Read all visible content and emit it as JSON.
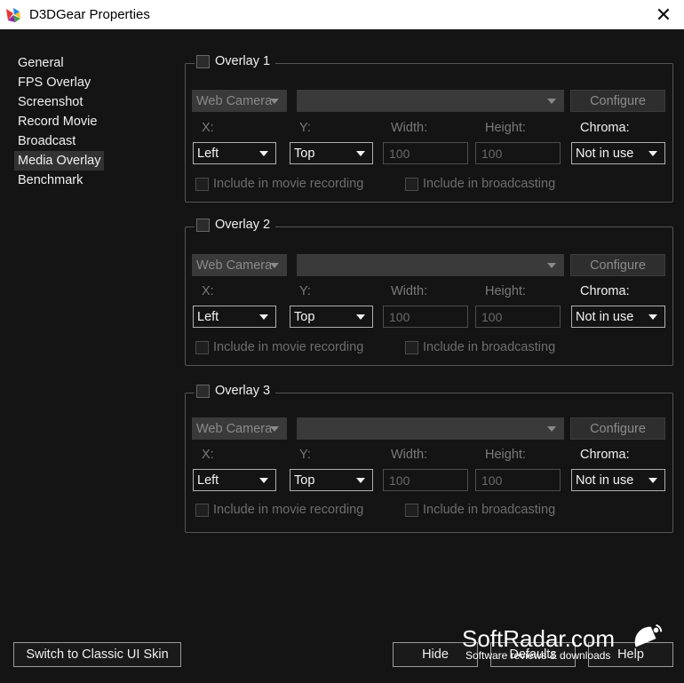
{
  "window": {
    "title": "D3DGear Properties",
    "close_glyph": "✕"
  },
  "nav": {
    "items": [
      "General",
      "FPS Overlay",
      "Screenshot",
      "Record Movie",
      "Broadcast",
      "Media Overlay",
      "Benchmark"
    ],
    "active_index": 5
  },
  "overlays": [
    {
      "title": "Overlay 1",
      "enabled": false,
      "source": "Web Camera",
      "device": "",
      "configure_label": "Configure",
      "x_label": "X:",
      "y_label": "Y:",
      "width_label": "Width:",
      "height_label": "Height:",
      "chroma_label": "Chroma:",
      "x_value": "Left",
      "y_value": "Top",
      "width_value": "100",
      "height_value": "100",
      "chroma_value": "Not in use",
      "movie_label": "Include in movie recording",
      "broadcast_label": "Include in broadcasting"
    },
    {
      "title": "Overlay 2",
      "enabled": false,
      "source": "Web Camera",
      "device": "",
      "configure_label": "Configure",
      "x_label": "X:",
      "y_label": "Y:",
      "width_label": "Width:",
      "height_label": "Height:",
      "chroma_label": "Chroma:",
      "x_value": "Left",
      "y_value": "Top",
      "width_value": "100",
      "height_value": "100",
      "chroma_value": "Not in use",
      "movie_label": "Include in movie recording",
      "broadcast_label": "Include in broadcasting"
    },
    {
      "title": "Overlay 3",
      "enabled": false,
      "source": "Web Camera",
      "device": "",
      "configure_label": "Configure",
      "x_label": "X:",
      "y_label": "Y:",
      "width_label": "Width:",
      "height_label": "Height:",
      "chroma_label": "Chroma:",
      "x_value": "Left",
      "y_value": "Top",
      "width_value": "100",
      "height_value": "100",
      "chroma_value": "Not in use",
      "movie_label": "Include in movie recording",
      "broadcast_label": "Include in broadcasting"
    }
  ],
  "footer": {
    "switch_label": "Switch to Classic UI Skin",
    "hide_label": "Hide",
    "defaults_label": "Defaults",
    "help_label": "Help"
  },
  "watermark": {
    "title": "SoftRadar.com",
    "subtitle": "Software reviews & downloads"
  },
  "colors": {
    "background": "#141414",
    "titlebar": "#ffffff",
    "nav_active": "#333333",
    "group_border": "#555555"
  }
}
